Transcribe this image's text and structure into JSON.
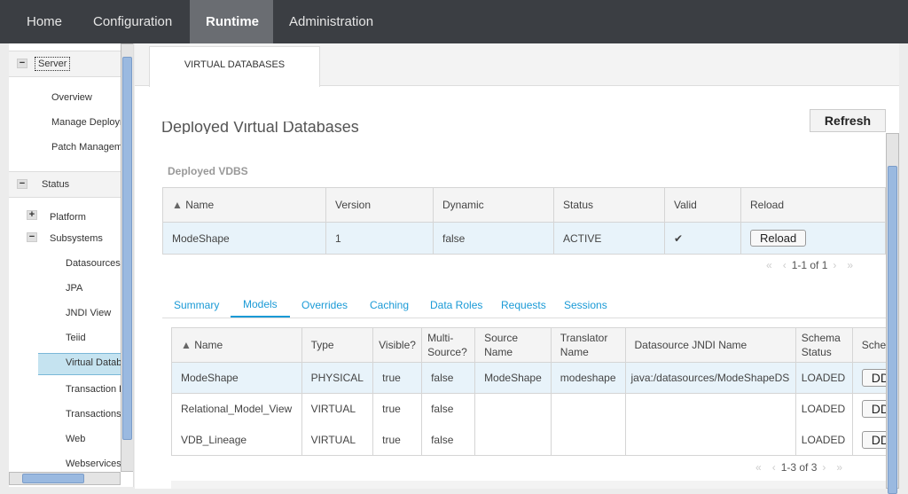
{
  "topnav": [
    "Home",
    "Configuration",
    "Runtime",
    "Administration"
  ],
  "sidebar": {
    "server": "Server",
    "server_items": [
      "Overview",
      "Manage Deployments",
      "Patch Management"
    ],
    "status": "Status",
    "platform": "Platform",
    "subsystems": "Subsystems",
    "subsystem_items": [
      "Datasources",
      "JPA",
      "JNDI View",
      "Teiid",
      "Virtual Databases",
      "Transaction Logs",
      "Transactions",
      "Web",
      "Webservices"
    ]
  },
  "main": {
    "tab": "VIRTUAL DATABASES",
    "heading": "Deployed Virtual Databases",
    "refresh": "Refresh",
    "vdbs_label": "Deployed VDBS",
    "vdb_table": {
      "headers": [
        "Name",
        "Version",
        "Dynamic",
        "Status",
        "Valid",
        "Reload"
      ],
      "rows": [
        {
          "name": "ModeShape",
          "version": "1",
          "dynamic": "false",
          "status": "ACTIVE",
          "valid": "✔",
          "reload": "Reload"
        }
      ]
    },
    "vdb_pager": "1-1 of 1",
    "subtabs": [
      "Summary",
      "Models",
      "Overrides",
      "Caching",
      "Data Roles",
      "Requests",
      "Sessions"
    ],
    "models_table": {
      "headers": [
        "Name",
        "Type",
        "Visible?",
        "Multi-Source?",
        "Source Name",
        "Translator Name",
        "Datasource JNDI Name",
        "Schema Status",
        "Schema"
      ],
      "rows": [
        [
          "ModeShape",
          "PHYSICAL",
          "true",
          "false",
          "ModeShape",
          "modeshape",
          "java:/datasources/ModeShapeDS",
          "LOADED",
          "DDL"
        ],
        [
          "Relational_Model_View",
          "VIRTUAL",
          "true",
          "false",
          "",
          "",
          "",
          "LOADED",
          "DDL"
        ],
        [
          "VDB_Lineage",
          "VIRTUAL",
          "true",
          "false",
          "",
          "",
          "",
          "LOADED",
          "DDL"
        ]
      ]
    },
    "models_pager": "1-3 of 3"
  },
  "colors": {
    "topbar": "#3b3e43",
    "active": "#6a6d72",
    "link": "#1a9ad6"
  }
}
